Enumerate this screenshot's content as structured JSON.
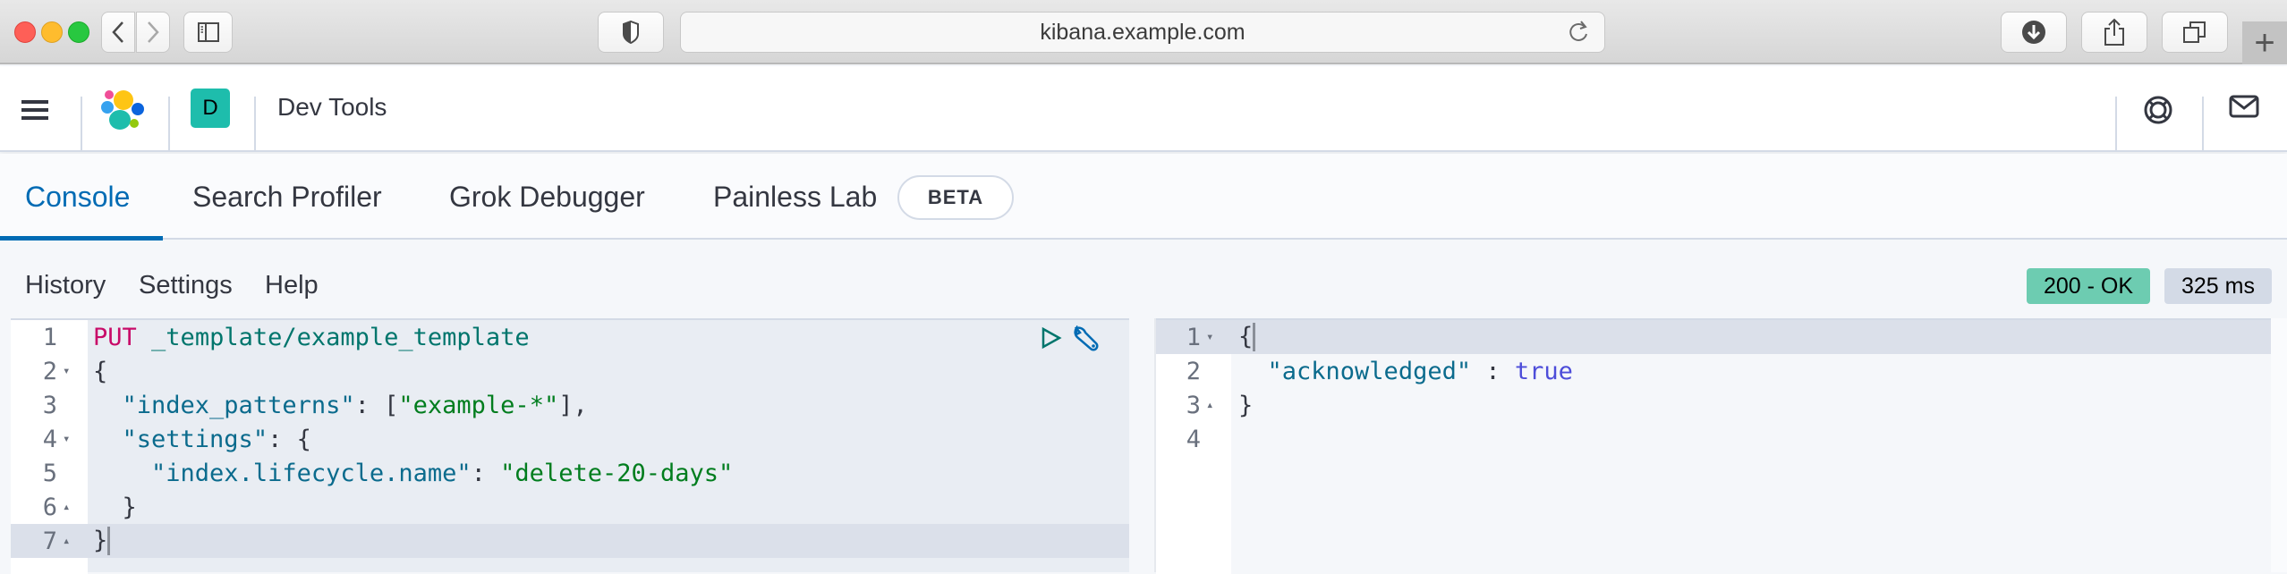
{
  "browser": {
    "url": "kibana.example.com",
    "icons": [
      "back-icon",
      "forward-icon",
      "sidebar-icon",
      "shield-icon",
      "reload-icon",
      "download-icon",
      "share-icon",
      "tabs-icon",
      "new-tab-icon"
    ],
    "new_tab_label": "+"
  },
  "header": {
    "app_title": "Dev Tools",
    "space_initial": "D",
    "space_color": "#1ebdac"
  },
  "tabs": [
    {
      "label": "Console",
      "active": true
    },
    {
      "label": "Search Profiler",
      "active": false
    },
    {
      "label": "Grok Debugger",
      "active": false
    },
    {
      "label": "Painless Lab",
      "active": false,
      "badge": "BETA"
    }
  ],
  "toolbar": {
    "history": "History",
    "settings": "Settings",
    "help": "Help",
    "status": "200 - OK",
    "status_color": "#6dccb1",
    "duration": "325 ms"
  },
  "request": {
    "lines": [
      {
        "n": "1",
        "fold": "",
        "tokens": [
          [
            "tok-method",
            "PUT"
          ],
          [
            "tok-punc",
            " "
          ],
          [
            "tok-url",
            "_template/example_template"
          ]
        ]
      },
      {
        "n": "2",
        "fold": "▾",
        "tokens": [
          [
            "tok-punc",
            "{"
          ]
        ]
      },
      {
        "n": "3",
        "fold": "",
        "tokens": [
          [
            "tok-punc",
            "  "
          ],
          [
            "tok-key",
            "\"index_patterns\""
          ],
          [
            "tok-punc",
            ": ["
          ],
          [
            "tok-str",
            "\"example-*\""
          ],
          [
            "tok-punc",
            "],"
          ]
        ]
      },
      {
        "n": "4",
        "fold": "▾",
        "tokens": [
          [
            "tok-punc",
            "  "
          ],
          [
            "tok-key",
            "\"settings\""
          ],
          [
            "tok-punc",
            ": {"
          ]
        ]
      },
      {
        "n": "5",
        "fold": "",
        "tokens": [
          [
            "tok-punc",
            "    "
          ],
          [
            "tok-key",
            "\"index.lifecycle.name\""
          ],
          [
            "tok-punc",
            ": "
          ],
          [
            "tok-str",
            "\"delete-20-days\""
          ]
        ]
      },
      {
        "n": "6",
        "fold": "▴",
        "tokens": [
          [
            "tok-punc",
            "  }"
          ]
        ]
      },
      {
        "n": "7",
        "fold": "▴",
        "tokens": [
          [
            "tok-punc",
            "}"
          ]
        ]
      }
    ],
    "active_line": 7
  },
  "response": {
    "lines": [
      {
        "n": "1",
        "fold": "▾",
        "tokens": [
          [
            "tok-punc",
            "{"
          ]
        ]
      },
      {
        "n": "2",
        "fold": "",
        "tokens": [
          [
            "tok-punc",
            "  "
          ],
          [
            "tok-key",
            "\"acknowledged\""
          ],
          [
            "tok-punc",
            " : "
          ],
          [
            "tok-bool",
            "true"
          ]
        ]
      },
      {
        "n": "3",
        "fold": "▴",
        "tokens": [
          [
            "tok-punc",
            "}"
          ]
        ]
      },
      {
        "n": "4",
        "fold": "",
        "tokens": []
      }
    ],
    "active_line": 1
  }
}
